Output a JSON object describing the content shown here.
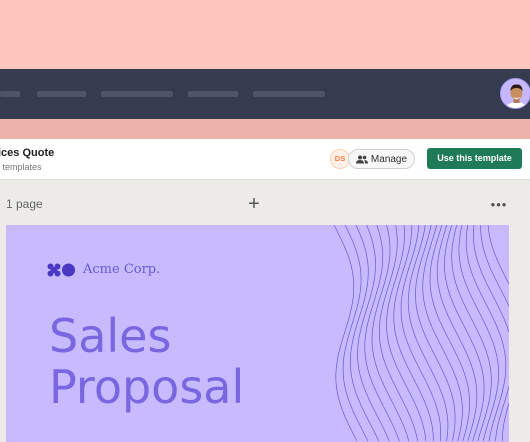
{
  "header": {
    "doc_title": "ices Quote",
    "doc_subtitle": "l templates"
  },
  "collaborators": {
    "badge": "DS"
  },
  "actions": {
    "manage_label": "Manage",
    "use_template_label": "Use this template"
  },
  "canvas": {
    "page_count": "1 page",
    "add_symbol": "+",
    "more_symbol": "•••"
  },
  "slide": {
    "brand_name": "Acme Corp.",
    "title_line1": "Sales",
    "title_line2": "Proposal"
  },
  "colors": {
    "accent": "#1f7a57",
    "slide_bg": "#c7baff",
    "slide_text": "#7a66e0",
    "navbar": "#353c4f",
    "top_band": "#ffc6bd"
  }
}
